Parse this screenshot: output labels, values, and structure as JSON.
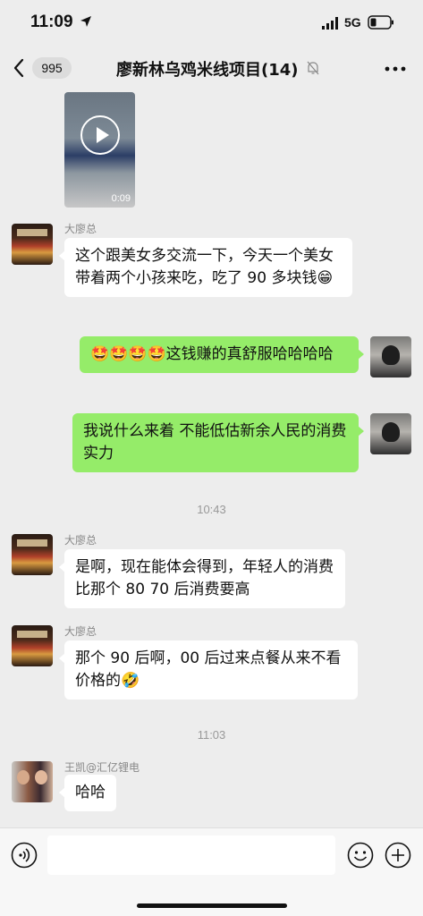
{
  "status": {
    "time": "11:09",
    "network": "5G",
    "location_icon": "location-arrow-icon",
    "signal_icon": "signal-icon",
    "battery_icon": "battery-icon"
  },
  "nav": {
    "unread_count": "995",
    "title": "廖新林乌鸡米线项目(14)",
    "back_icon": "chevron-left-icon",
    "mute_icon": "bell-muted-icon",
    "more_icon": "more-dots-icon"
  },
  "video": {
    "duration": "0:09"
  },
  "messages": [
    {
      "sender": "大廖总",
      "side": "in",
      "text": "这个跟美女多交流一下，今天一个美女带着两个小孩来吃，吃了 90 多块钱😁"
    },
    {
      "side": "out",
      "text": "🤩🤩🤩🤩这钱赚的真舒服哈哈哈哈"
    },
    {
      "side": "out",
      "text": "我说什么来着 不能低估新余人民的消费实力"
    },
    {
      "sender": "大廖总",
      "side": "in",
      "text": "是啊，现在能体会得到，年轻人的消费比那个 80 70 后消费要高"
    },
    {
      "sender": "大廖总",
      "side": "in",
      "text": "那个 90 后啊，00 后过来点餐从来不看价格的🤣"
    },
    {
      "sender": "王凯@汇亿锂电",
      "side": "in",
      "text": "哈哈"
    }
  ],
  "timestamps": [
    "10:43",
    "11:03"
  ],
  "input": {
    "placeholder": "",
    "voice_icon": "voice-icon",
    "emoji_icon": "emoji-icon",
    "plus_icon": "plus-icon"
  },
  "colors": {
    "background": "#ededed",
    "bubble_out": "#95ec69",
    "bubble_in": "#ffffff"
  }
}
